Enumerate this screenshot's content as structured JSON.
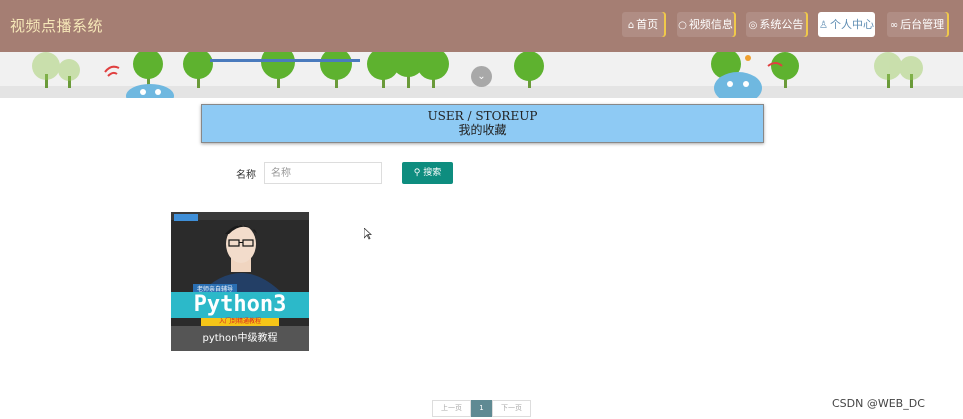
{
  "header": {
    "site_title": "视频点播系统",
    "nav": [
      {
        "label": "首页",
        "icon": "home-icon"
      },
      {
        "label": "视频信息",
        "icon": "chat-icon"
      },
      {
        "label": "系统公告",
        "icon": "announcement-icon"
      },
      {
        "label": "个人中心",
        "icon": "user-icon",
        "active": true
      },
      {
        "label": "后台管理",
        "icon": "link-icon"
      }
    ]
  },
  "section": {
    "title_en": "USER / STOREUP",
    "title_zh": "我的收藏"
  },
  "search": {
    "label": "名称",
    "placeholder": "名称",
    "button_label": "搜索"
  },
  "favorites": [
    {
      "title": "python中级教程",
      "thumbnail_text": "Python3",
      "thumbnail_badge": "老师亲自辅导",
      "thumbnail_sub": "入门到精通教程"
    }
  ],
  "pagination": {
    "prev_label": "上一页",
    "current_page": "1",
    "next_label": "下一页"
  },
  "watermark": "CSDN @WEB_DC",
  "colors": {
    "header_bg": "#a57e73",
    "section_bg": "#8ecaf4",
    "search_button": "#0e8d7f",
    "active_page": "#5f8a93"
  }
}
